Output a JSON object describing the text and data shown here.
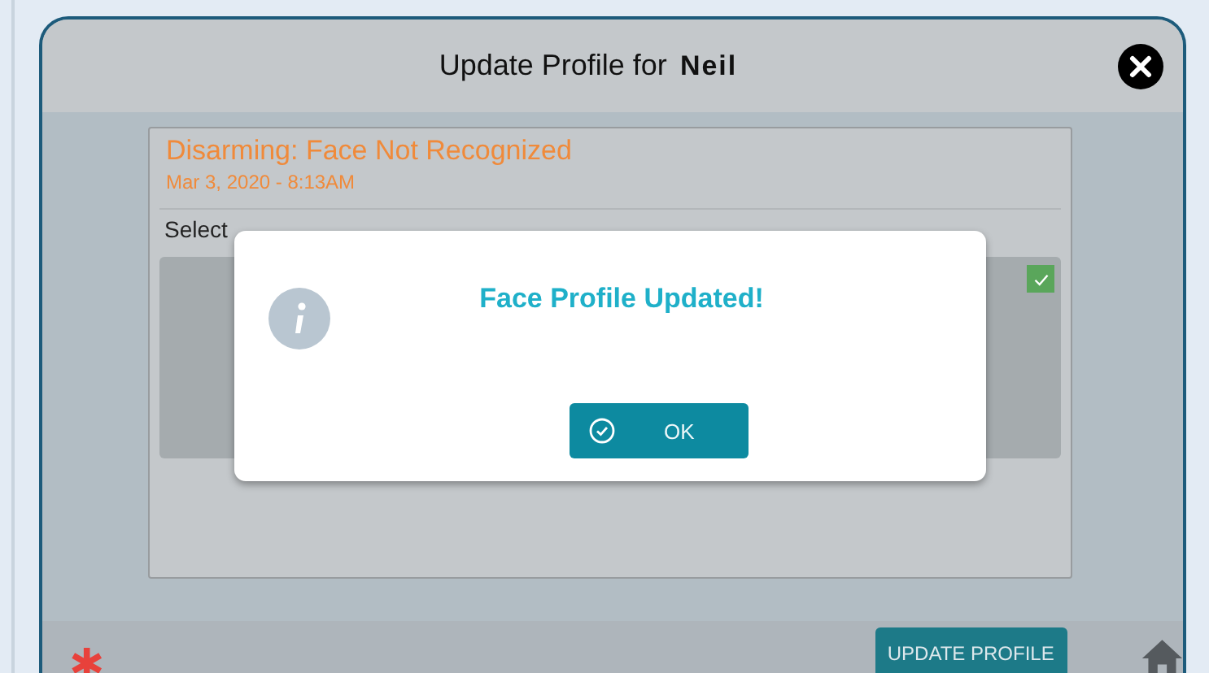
{
  "modal": {
    "title": "Update Profile for",
    "user": "Neil"
  },
  "event": {
    "title": "Disarming: Face Not Recognized",
    "time": "Mar 3, 2020 - 8:13AM",
    "instruction": "Select"
  },
  "image_panel": {
    "checked": true
  },
  "footer": {
    "button": "UPDATE PROFILE"
  },
  "dialog": {
    "message": "Face Profile Updated!",
    "button": "OK"
  }
}
